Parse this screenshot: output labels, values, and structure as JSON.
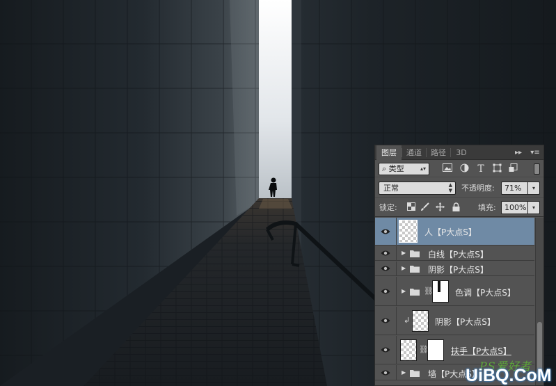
{
  "panel": {
    "tabs": [
      "图层",
      "通道",
      "路径",
      "3D"
    ],
    "tab_menu_collapse": "▸▸",
    "tab_menu_options": "▾≡",
    "filter": {
      "label": "类型",
      "icon": "search-icon"
    },
    "filter_icons": [
      "image-icon",
      "adjustment-icon",
      "text-icon",
      "shape-icon",
      "smart-object-icon"
    ],
    "blend_mode": "正常",
    "opacity_label": "不透明度:",
    "opacity_value": "71%",
    "lock_label": "锁定:",
    "lock_icons": [
      "lock-transparent-icon",
      "lock-paint-icon",
      "lock-position-icon",
      "lock-all-icon"
    ],
    "fill_label": "填充:",
    "fill_value": "100%"
  },
  "layers": [
    {
      "name": "人【P大点S】",
      "kind": "layer",
      "selected": true
    },
    {
      "name": "白线【P大点S】",
      "kind": "group"
    },
    {
      "name": "阴影【P大点S】",
      "kind": "group"
    },
    {
      "name": "色调【P大点S】",
      "kind": "group-masked"
    },
    {
      "name": "阴影【P大点S】",
      "kind": "clipped-layer"
    },
    {
      "name": "扶手【P大点S】",
      "kind": "masked-layer"
    },
    {
      "name": "墙【P大点S】",
      "kind": "group"
    }
  ],
  "watermark": {
    "top": "PS爱好者",
    "bottom": "UiBQ.CoM"
  }
}
